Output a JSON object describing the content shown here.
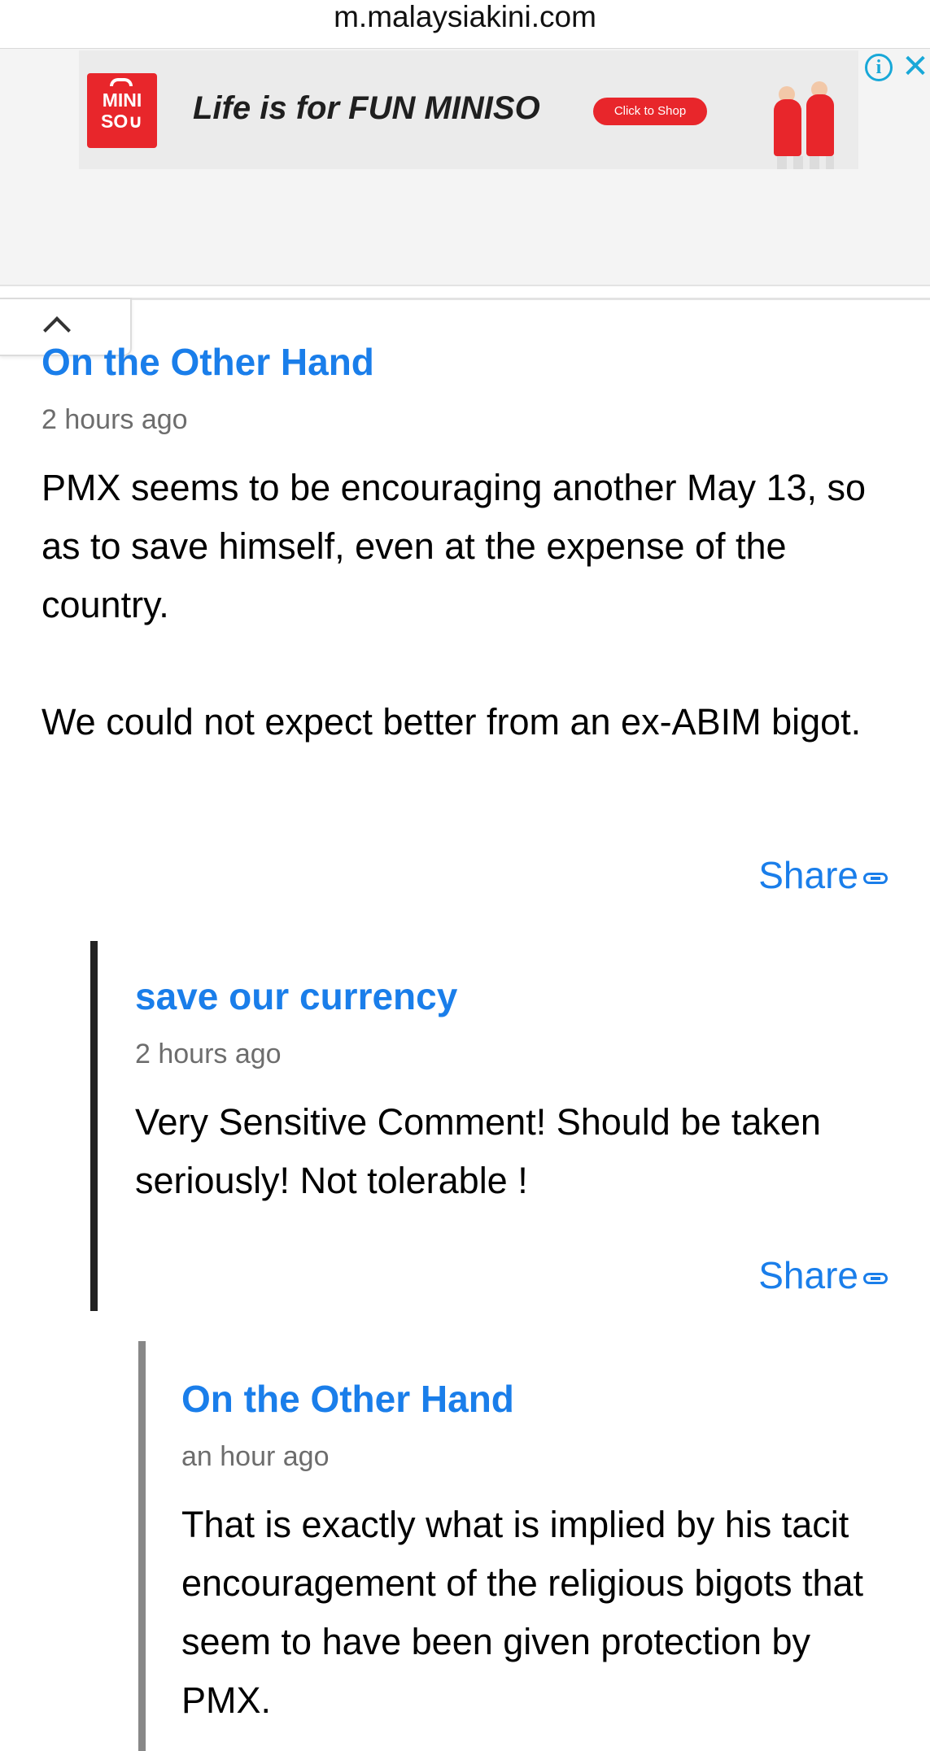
{
  "browser": {
    "url": "m.malaysiakini.com"
  },
  "ad": {
    "logo_line1": "MINI",
    "logo_line2": "SO∪",
    "tagline": "Life is for FUN MINISO",
    "cta": "Click to Shop",
    "info_icon": "i",
    "close_icon": "✕"
  },
  "scroll_top": {
    "icon": "chevron-up-icon"
  },
  "comments": [
    {
      "author": "On the Other Hand",
      "time": "2 hours ago",
      "paragraphs": [
        "PMX seems to be encouraging another May 13, so as to save himself, even at the expense of the country.",
        "We could not expect better from an ex-ABIM bigot."
      ],
      "share": "Share"
    },
    {
      "author": "save our currency",
      "time": "2 hours ago",
      "paragraphs": [
        "Very Sensitive Comment! Should be taken seriously! Not tolerable !"
      ],
      "share": "Share"
    },
    {
      "author": "On the Other Hand",
      "time": "an hour ago",
      "paragraphs": [
        "That is exactly what is implied by his tacit encouragement of the religious bigots that seem to have been given protection by PMX."
      ]
    }
  ],
  "colors": {
    "author_link": "#1a7eea",
    "timestamp": "#6d6d6d",
    "thread_line_level1": "#222222",
    "thread_line_level2": "#888888",
    "ad_brand": "#e8262b",
    "ad_controls": "#18a8d8"
  }
}
